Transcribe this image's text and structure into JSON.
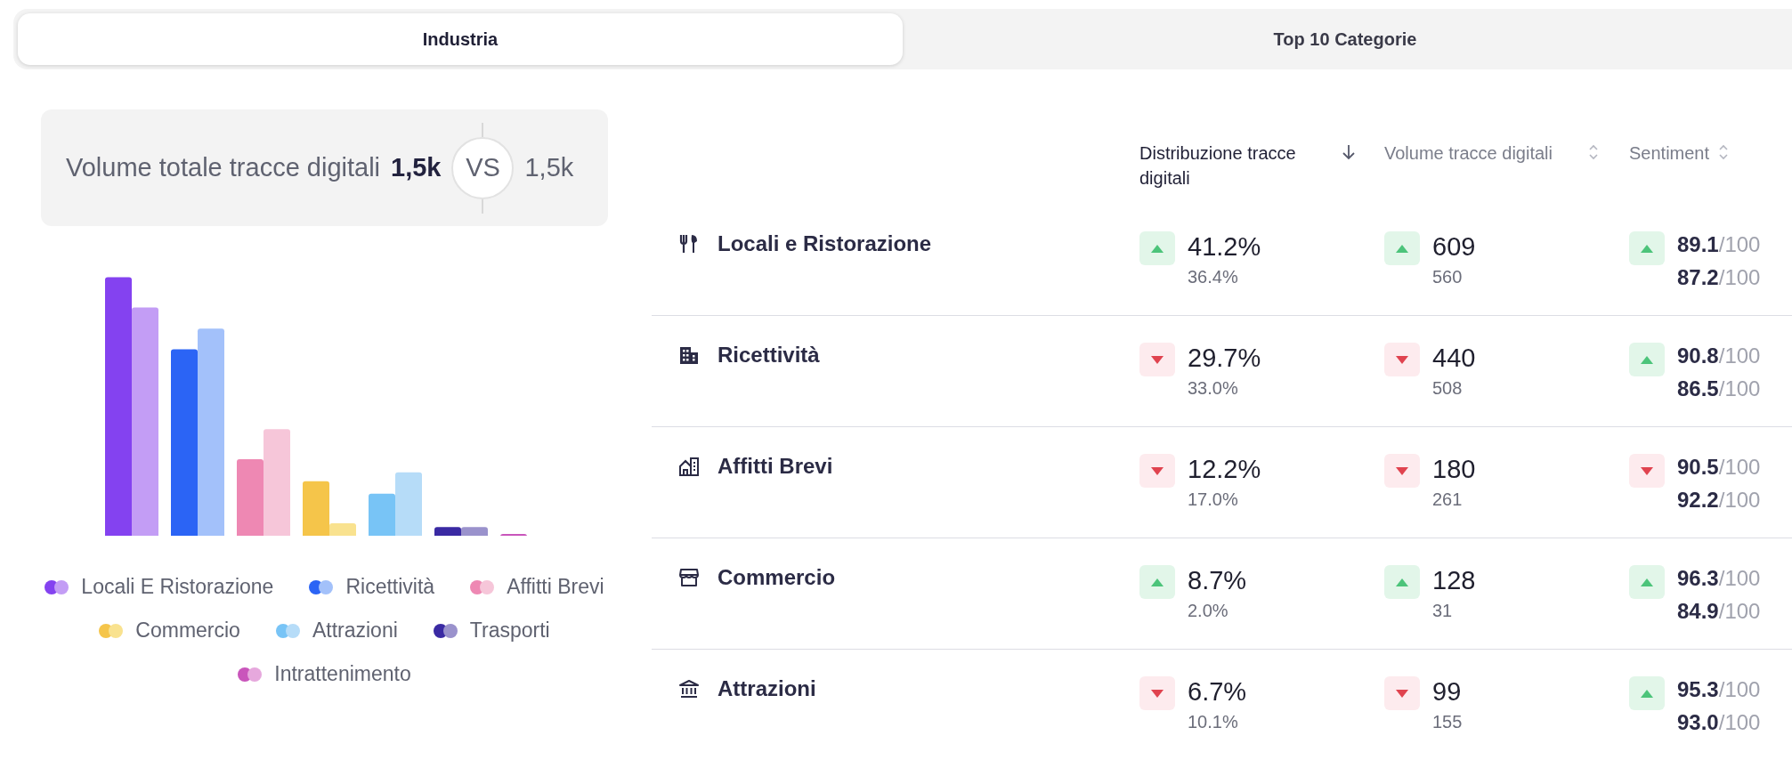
{
  "tabs": [
    {
      "label": "Industria",
      "selected": true
    },
    {
      "label": "Top 10 Categorie",
      "selected": false
    }
  ],
  "summary": {
    "label": "Volume totale tracce digitali",
    "value": "1,5k",
    "vs": "VS",
    "compare_value": "1,5k"
  },
  "legend": [
    {
      "label": "Locali E Ristorazione",
      "dots": [
        {
          "color": "#8442f0"
        },
        {
          "color": "#c39df5"
        }
      ]
    },
    {
      "label": "Ricettività",
      "dots": [
        {
          "color": "#2b64f5"
        },
        {
          "color": "#a3c1fa"
        }
      ]
    },
    {
      "label": "Affitti Brevi",
      "dots": [
        {
          "color": "#ee88b3"
        },
        {
          "color": "#f6c6d9"
        }
      ]
    },
    {
      "label": "Commercio",
      "dots": [
        {
          "color": "#f5c54a"
        },
        {
          "color": "#f9e28f"
        }
      ]
    },
    {
      "label": "Attrazioni",
      "dots": [
        {
          "color": "#78c4f6"
        },
        {
          "color": "#b6dcf8"
        }
      ]
    },
    {
      "label": "Trasporti",
      "dots": [
        {
          "color": "#3a2aa3"
        },
        {
          "color": "#9a92cc"
        }
      ]
    },
    {
      "label": "Intrattenimento",
      "dots": [
        {
          "color": "#c955bb"
        },
        {
          "color": "#e6a8dd"
        }
      ]
    }
  ],
  "table": {
    "columns": [
      {
        "label": "Distribuzione tracce digitali",
        "sorted": true
      },
      {
        "label": "Volume tracce digitali",
        "sorted": false
      },
      {
        "label": "Sentiment",
        "sorted": false
      }
    ],
    "rows": [
      {
        "name": "Locali e Ristorazione",
        "distribution": {
          "rising": true,
          "value": "41.2%",
          "previous": "36.4%"
        },
        "volume": {
          "rising": true,
          "value": "609",
          "previous": "560"
        },
        "sentiment": {
          "rising": true,
          "value": "89.1",
          "scale": "/100",
          "previous": "87.2",
          "previous_scale": "/100"
        }
      },
      {
        "name": "Ricettività",
        "distribution": {
          "rising": false,
          "value": "29.7%",
          "previous": "33.0%"
        },
        "volume": {
          "rising": false,
          "value": "440",
          "previous": "508"
        },
        "sentiment": {
          "rising": true,
          "value": "90.8",
          "scale": "/100",
          "previous": "86.5",
          "previous_scale": "/100"
        }
      },
      {
        "name": "Affitti Brevi",
        "distribution": {
          "rising": false,
          "value": "12.2%",
          "previous": "17.0%"
        },
        "volume": {
          "rising": false,
          "value": "180",
          "previous": "261"
        },
        "sentiment": {
          "rising": false,
          "value": "90.5",
          "scale": "/100",
          "previous": "92.2",
          "previous_scale": "/100"
        }
      },
      {
        "name": "Commercio",
        "distribution": {
          "rising": true,
          "value": "8.7%",
          "previous": "2.0%"
        },
        "volume": {
          "rising": true,
          "value": "128",
          "previous": "31"
        },
        "sentiment": {
          "rising": true,
          "value": "96.3",
          "scale": "/100",
          "previous": "84.9",
          "previous_scale": "/100"
        }
      },
      {
        "name": "Attrazioni",
        "distribution": {
          "rising": false,
          "value": "6.7%",
          "previous": "10.1%"
        },
        "volume": {
          "rising": false,
          "value": "99",
          "previous": "155"
        },
        "sentiment": {
          "rising": true,
          "value": "95.3",
          "scale": "/100",
          "previous": "93.0",
          "previous_scale": "/100"
        }
      }
    ]
  }
}
